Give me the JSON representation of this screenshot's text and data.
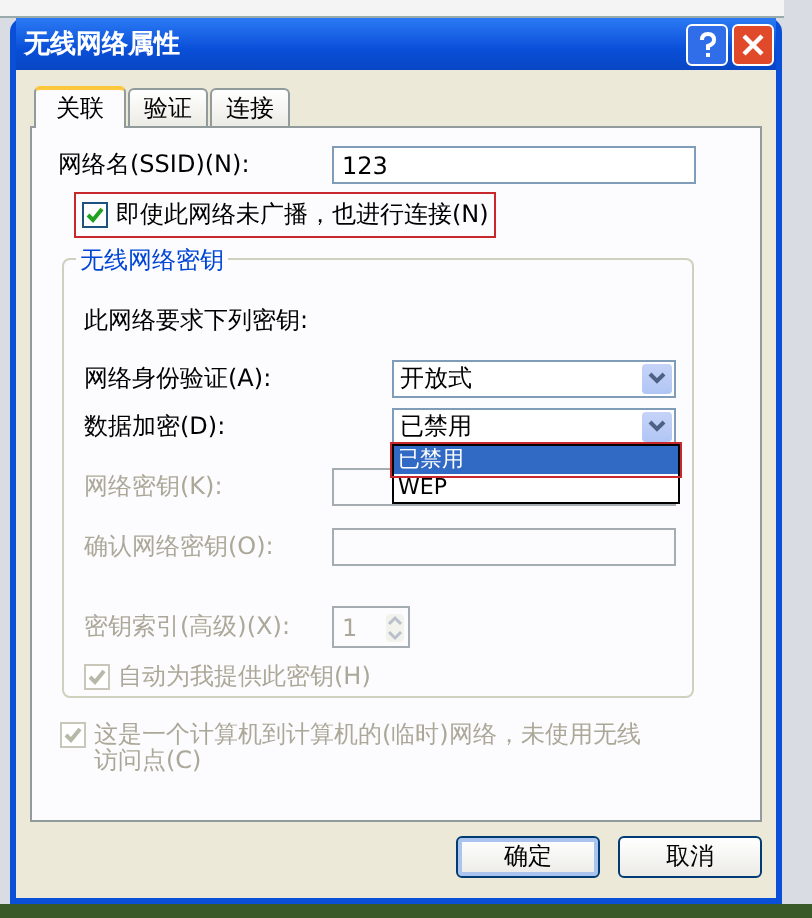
{
  "window": {
    "title": "无线网络属性"
  },
  "tabs": [
    {
      "label": "关联",
      "selected": true
    },
    {
      "label": "验证",
      "selected": false
    },
    {
      "label": "连接",
      "selected": false
    }
  ],
  "ssid": {
    "label": "网络名(SSID)(N):",
    "value": "123"
  },
  "broadcast_option": {
    "label": "即使此网络未广播，也进行连接(N)",
    "checked": true,
    "highlighted": true
  },
  "key_group": {
    "title": "无线网络密钥",
    "intro": "此网络要求下列密钥:",
    "authentication": {
      "label": "网络身份验证(A):",
      "value": "开放式"
    },
    "encryption": {
      "label": "数据加密(D):",
      "value": "已禁用",
      "expanded": true,
      "options": [
        {
          "label": "已禁用",
          "selected": true,
          "highlighted": true
        },
        {
          "label": "WEP",
          "selected": false,
          "highlighted": false
        }
      ]
    },
    "network_key": {
      "label": "网络密钥(K):",
      "disabled": true
    },
    "confirm_key": {
      "label": "确认网络密钥(O):",
      "disabled": true
    },
    "key_index": {
      "label": "密钥索引(高级)(X):",
      "value": "1",
      "disabled": true
    },
    "auto_key": {
      "label": "自动为我提供此密钥(H)",
      "checked": true,
      "disabled": true
    }
  },
  "adhoc_option": {
    "label": "这是一个计算机到计算机的(临时)网络，未使用无线访问点(C)",
    "checked": true,
    "disabled": true
  },
  "buttons": [
    {
      "label": "确定",
      "focused": true
    },
    {
      "label": "取消",
      "focused": false
    }
  ]
}
